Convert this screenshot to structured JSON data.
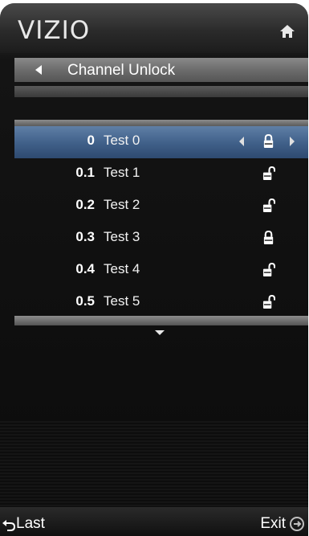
{
  "header": {
    "logo": "VIZIO",
    "home_icon": "home-icon"
  },
  "title_bar": {
    "title": "Channel Unlock",
    "back_icon": "left-triangle-icon"
  },
  "channels": [
    {
      "number": "0",
      "name": "Test 0",
      "locked": true,
      "selected": true
    },
    {
      "number": "0.1",
      "name": "Test 1",
      "locked": false,
      "selected": false
    },
    {
      "number": "0.2",
      "name": "Test 2",
      "locked": false,
      "selected": false
    },
    {
      "number": "0.3",
      "name": "Test 3",
      "locked": true,
      "selected": false
    },
    {
      "number": "0.4",
      "name": "Test 4",
      "locked": false,
      "selected": false
    },
    {
      "number": "0.5",
      "name": "Test 5",
      "locked": false,
      "selected": false
    }
  ],
  "footer": {
    "last_label": "Last",
    "exit_label": "Exit"
  },
  "colors": {
    "selected_row": "#3f5f88",
    "background": "#0b0b0b",
    "title_bar": "#6c6c6c"
  }
}
